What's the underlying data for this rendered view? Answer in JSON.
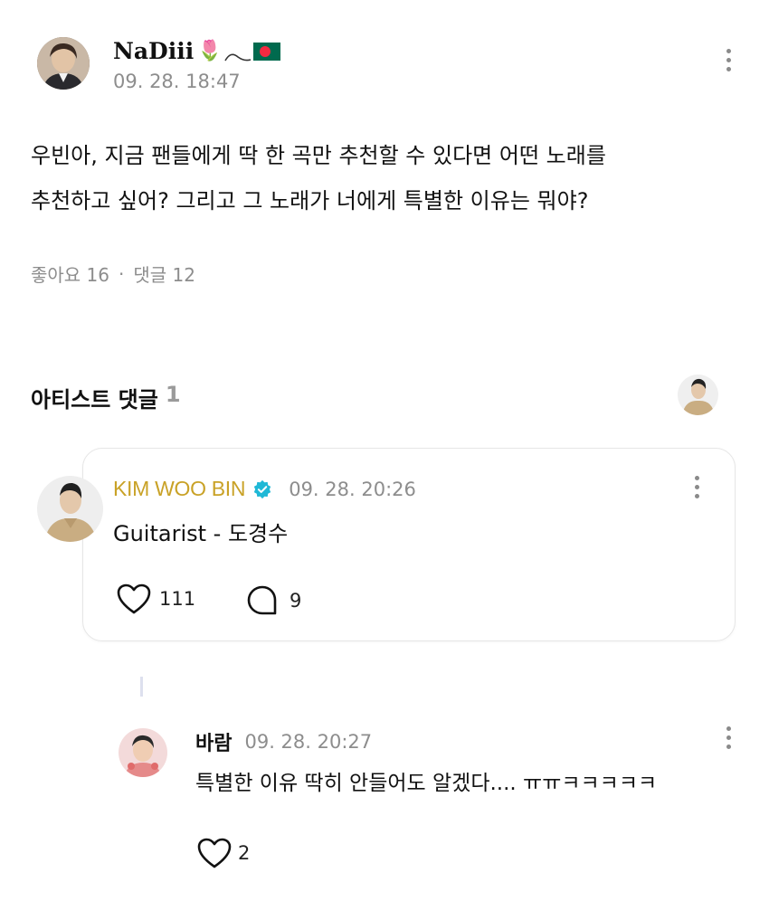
{
  "post": {
    "author": "NaDiii",
    "author_emoji": "🌷",
    "timestamp": "09. 28. 18:47",
    "body_line1": "우빈아, 지금 팬들에게 딱 한 곡만 추천할 수 있다면 어떤 노래를",
    "body_line2": "추천하고 싶어? 그리고 그 노래가 너에게 특별한 이유는 뭐야?",
    "likes_label": "좋아요 16",
    "separator": "·",
    "comments_label": "댓글 12",
    "flag_color": "#006a4e",
    "flag_dot_color": "#f42a41"
  },
  "artist_section": {
    "title": "아티스트 댓글",
    "count": "1"
  },
  "artist_comment": {
    "author": "KIM WOO BIN",
    "author_color": "#c9a227",
    "verified_color": "#1fb8d6",
    "timestamp": "09. 28. 20:26",
    "text": "Guitarist - 도경수",
    "like_count": "111",
    "reply_count": "9"
  },
  "reply": {
    "author": "바람",
    "timestamp": "09. 28. 20:27",
    "text": "특별한 이유 딱히 안들어도 알겠다.... ㅠㅠㅋㅋㅋㅋㅋ",
    "like_count": "2"
  }
}
